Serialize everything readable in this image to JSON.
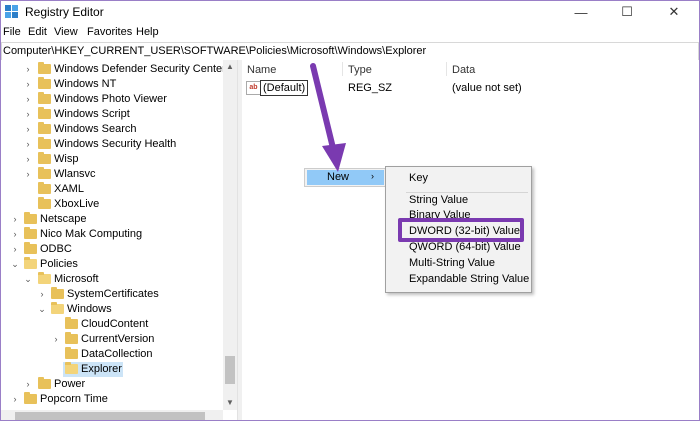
{
  "window": {
    "title": "Registry Editor",
    "minimize_glyph": "—",
    "maximize_glyph": "☐",
    "close_glyph": "✕"
  },
  "menu": {
    "file": "File",
    "edit": "Edit",
    "view": "View",
    "favorites": "Favorites",
    "help": "Help"
  },
  "address": {
    "path": "Computer\\HKEY_CURRENT_USER\\SOFTWARE\\Policies\\Microsoft\\Windows\\Explorer"
  },
  "tree": {
    "items": [
      {
        "label": "Windows Defender Security Center",
        "expander": "›"
      },
      {
        "label": "Windows NT",
        "expander": "›"
      },
      {
        "label": "Windows Photo Viewer",
        "expander": "›"
      },
      {
        "label": "Windows Script",
        "expander": "›"
      },
      {
        "label": "Windows Search",
        "expander": "›"
      },
      {
        "label": "Windows Security Health",
        "expander": "›"
      },
      {
        "label": "Wisp",
        "expander": "›"
      },
      {
        "label": "Wlansvc",
        "expander": "›"
      },
      {
        "label": "XAML",
        "expander": ""
      },
      {
        "label": "XboxLive",
        "expander": ""
      },
      {
        "label": "Netscape",
        "expander": "›"
      },
      {
        "label": "Nico Mak Computing",
        "expander": "›"
      },
      {
        "label": "ODBC",
        "expander": "›"
      },
      {
        "label": "Policies",
        "expander": "⌄"
      },
      {
        "label": "Microsoft",
        "expander": "⌄"
      },
      {
        "label": "SystemCertificates",
        "expander": "›"
      },
      {
        "label": "Windows",
        "expander": "⌄"
      },
      {
        "label": "CloudContent",
        "expander": ""
      },
      {
        "label": "CurrentVersion",
        "expander": "›"
      },
      {
        "label": "DataCollection",
        "expander": ""
      },
      {
        "label": "Explorer",
        "expander": ""
      },
      {
        "label": "Power",
        "expander": "›"
      },
      {
        "label": "Popcorn Time",
        "expander": "›"
      }
    ]
  },
  "list": {
    "columns": {
      "name": "Name",
      "type": "Type",
      "data": "Data"
    },
    "rows": [
      {
        "icon": "ab",
        "name": "(Default)",
        "type": "REG_SZ",
        "data": "(value not set)"
      }
    ]
  },
  "context_menu": {
    "new_label": "New",
    "new_arrow": "›",
    "submenu": [
      "Key",
      "String Value",
      "Binary Value",
      "DWORD (32-bit) Value",
      "QWORD (64-bit) Value",
      "Multi-String Value",
      "Expandable String Value"
    ]
  },
  "colors": {
    "annotation_purple": "#7a3ab0",
    "menu_highlight": "#91c9f7",
    "selection": "#cce4f7",
    "folder": "#e8c15a"
  }
}
